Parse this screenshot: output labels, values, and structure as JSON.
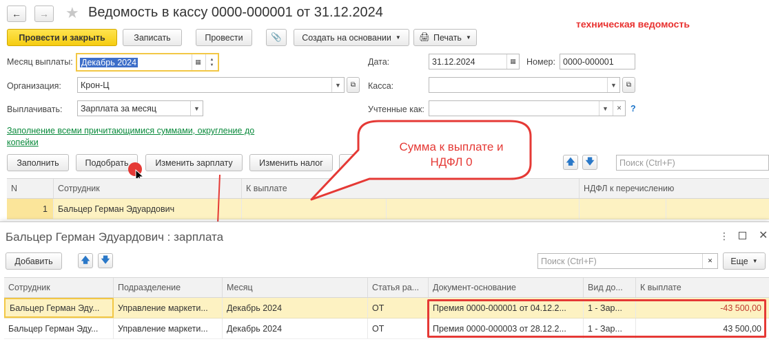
{
  "window": {
    "title": "Ведомость в кассу 0000-000001 от 31.12.2024",
    "note": "техническая ведомость"
  },
  "toolbar": {
    "post_close": "Провести и закрыть",
    "save": "Записать",
    "post": "Провести",
    "create_based": "Создать на основании",
    "print": "Печать"
  },
  "form": {
    "month_label": "Месяц выплаты:",
    "month_value": "Декабрь 2024",
    "org_label": "Организация:",
    "org_value": "Крон-Ц",
    "pay_label": "Выплачивать:",
    "pay_value": "Зарплата за месяц",
    "date_label": "Дата:",
    "date_value": "31.12.2024",
    "number_label": "Номер:",
    "number_value": "0000-000001",
    "cash_label": "Касса:",
    "cash_value": "",
    "accounted_label": "Учтенные как:",
    "accounted_value": "",
    "help": "?",
    "fill_link": "Заполнение всеми причитающимися суммами, округление до копейки"
  },
  "actions": {
    "fill": "Заполнить",
    "pick": "Подобрать",
    "change_salary": "Изменить зарплату",
    "change_tax": "Изменить налог",
    "search_placeholder": "Поиск (Ctrl+F)"
  },
  "callout": "Сумма к выплате и НДФЛ 0",
  "main_table": {
    "headers": [
      "N",
      "Сотрудник",
      "К выплате",
      "НДФЛ к перечислению"
    ],
    "rows": [
      {
        "n": "1",
        "employee": "Бальцер Герман Эдуардович",
        "amount": "",
        "tax": ""
      }
    ]
  },
  "subwindow": {
    "title": "Бальцер Герман Эдуардович : зарплата",
    "add": "Добавить",
    "search_placeholder": "Поиск (Ctrl+F)",
    "more": "Еще",
    "headers": [
      "Сотрудник",
      "Подразделение",
      "Месяц",
      "Статья ра...",
      "Документ-основание",
      "Вид до...",
      "К выплате"
    ],
    "rows": [
      {
        "employee": "Бальцер Герман Эду...",
        "dept": "Управление маркети...",
        "month": "Декабрь 2024",
        "article": "ОТ",
        "doc": "Премия 0000-000001 от 04.12.2...",
        "kind": "1 - Зар...",
        "amount": "-43 500,00"
      },
      {
        "employee": "Бальцер Герман Эду...",
        "dept": "Управление маркети...",
        "month": "Декабрь 2024",
        "article": "ОТ",
        "doc": "Премия 0000-000003 от 28.12.2...",
        "kind": "1 - Зар...",
        "amount": "43 500,00"
      }
    ]
  },
  "colors": {
    "accent": "#f5cc11",
    "note": "#e8312f",
    "link": "#0a8a3c",
    "selected_row": "#fdf2c2",
    "callout_border": "#e53935",
    "negative": "#c0392b"
  }
}
